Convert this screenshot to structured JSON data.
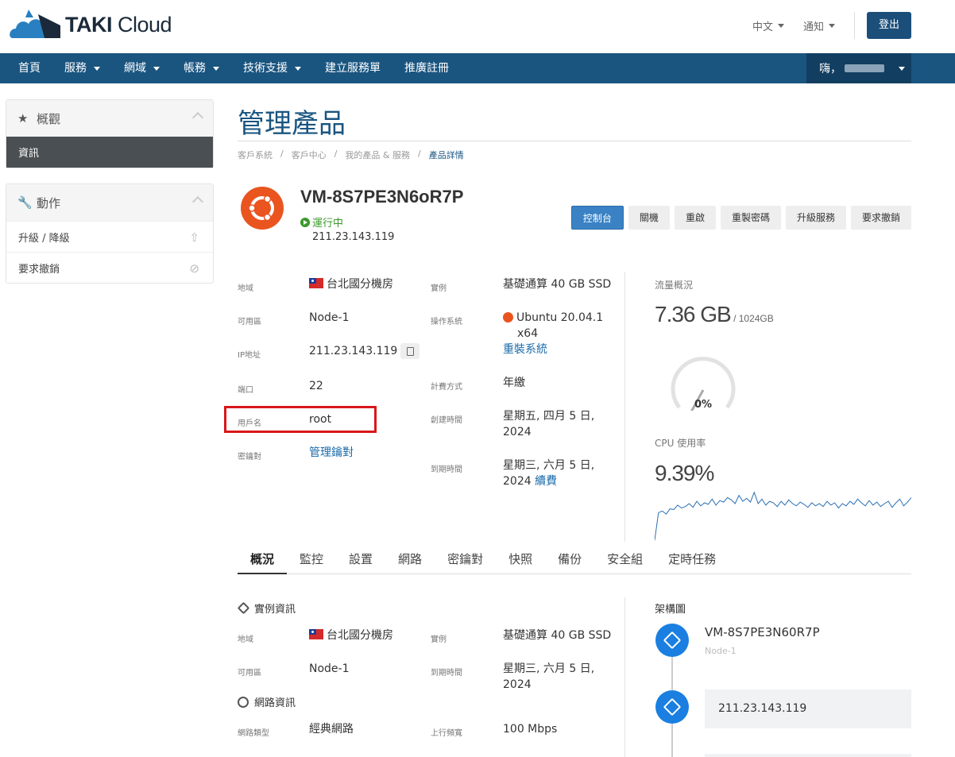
{
  "brand": {
    "name_bold": "TAKI",
    "name_rest": "Cloud"
  },
  "header": {
    "language": "中文",
    "notifications": "通知",
    "logout": "登出"
  },
  "nav": {
    "items": [
      {
        "label": "首頁",
        "dropdown": false
      },
      {
        "label": "服務",
        "dropdown": true
      },
      {
        "label": "網域",
        "dropdown": true
      },
      {
        "label": "帳務",
        "dropdown": true
      },
      {
        "label": "技術支援",
        "dropdown": true
      },
      {
        "label": "建立服務單",
        "dropdown": false
      },
      {
        "label": "推廣註冊",
        "dropdown": false
      }
    ],
    "greeting": "嗨，"
  },
  "sidebar": {
    "overview": {
      "title": "概觀",
      "items": [
        {
          "label": "資訊"
        }
      ]
    },
    "actions": {
      "title": "動作",
      "items": [
        {
          "label": "升級 / 降級"
        },
        {
          "label": "要求撤銷"
        }
      ]
    }
  },
  "page": {
    "title": "管理產品",
    "breadcrumb": [
      "客戶系統",
      "/",
      "客戶中心",
      "/",
      "我的產品 & 服務",
      "/",
      "產品詳情"
    ]
  },
  "vm": {
    "name": "VM-8S7PE3N6oR7P",
    "status": "運行中",
    "ip": "211.23.143.119"
  },
  "action_buttons": [
    "控制台",
    "關機",
    "重啟",
    "重製密碼",
    "升級服務",
    "要求撤銷"
  ],
  "details_left": {
    "region_label": "地域",
    "region_value": "台北國分機房",
    "zone_label": "可用區",
    "zone_value": "Node-1",
    "ip_label": "IP地址",
    "ip_value": "211.23.143.119",
    "port_label": "端口",
    "port_value": "22",
    "user_label": "用戶名",
    "user_value": "root",
    "key_label": "密鑰對",
    "key_value": "管理鑰對"
  },
  "details_right": {
    "instance_label": "實例",
    "instance_value": "基礎通算 40 GB SSD",
    "os_label": "操作系統",
    "os_value_1": "Ubuntu 20.04.1",
    "os_value_2": "x64",
    "os_reinstall": "重裝系統",
    "billing_label": "計費方式",
    "billing_value": "年繳",
    "created_label": "創建時間",
    "created_value_1": "星期五, 四月 5 日,",
    "created_value_2": "2024",
    "expire_label": "到期時間",
    "expire_value_1": "星期三, 六月 5 日,",
    "expire_value_2": "2024",
    "renew": "續費"
  },
  "stats": {
    "traffic_label": "流量概況",
    "traffic_used": "7.36 GB",
    "traffic_total": " / 1024GB",
    "traffic_percent": "0%",
    "traffic_fraction": 0.007,
    "cpu_label": "CPU 使用率",
    "cpu_value": "9.39%"
  },
  "cpu_series": [
    3,
    40,
    42,
    38,
    45,
    44,
    50,
    46,
    48,
    52,
    47,
    55,
    49,
    53,
    51,
    58,
    50,
    56,
    54,
    60,
    57,
    52,
    63,
    55,
    59,
    54,
    67,
    52,
    58,
    50,
    55,
    53,
    48,
    55,
    50,
    57,
    52,
    49,
    54,
    51,
    47,
    53,
    49,
    52,
    48,
    55,
    50,
    53,
    46,
    52,
    49,
    55,
    51,
    58,
    53,
    49,
    56,
    50,
    54,
    48,
    52,
    55,
    47,
    53,
    58,
    49,
    54,
    60
  ],
  "tabs": [
    "概況",
    "監控",
    "設置",
    "網路",
    "密鑰對",
    "快照",
    "備份",
    "安全組",
    "定時任務"
  ],
  "overview": {
    "instance_section": "實例資訊",
    "region_label": "地域",
    "region_value": "台北國分機房",
    "zone_label": "可用區",
    "zone_value": "Node-1",
    "instance_label": "實例",
    "instance_value": "基礎通算 40 GB SSD",
    "expire_label": "到期時間",
    "expire_value_1": "星期三, 六月 5 日,",
    "expire_value_2": "2024",
    "network_section": "網路資訊",
    "net_type_label": "網路類型",
    "net_type_value": "經典網路",
    "bandwidth_label": "上行頻寬",
    "bandwidth_value": "100 Mbps"
  },
  "architecture": {
    "title": "架構圖",
    "vm_name": "VM-8S7PE3N60R7P",
    "vm_node": "Node-1",
    "ip": "211.23.143.119"
  }
}
